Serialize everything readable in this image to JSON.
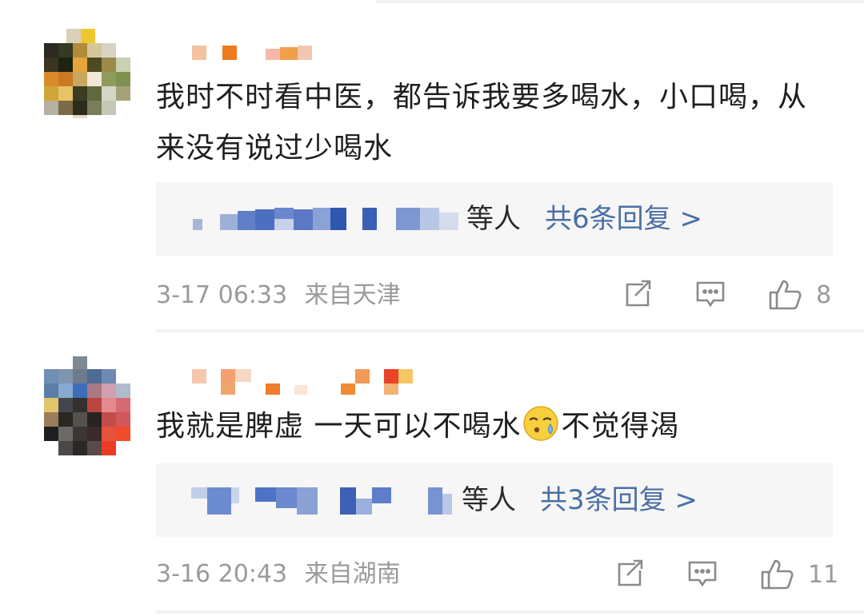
{
  "comments": [
    {
      "text": "我时不时看中医，都告诉我要多喝水，小口喝，从来没有说过少喝水",
      "reply_who": "等人",
      "reply_count": "共6条回复 >",
      "time": "3-17 06:33",
      "location": "来自天津",
      "likes": "8"
    },
    {
      "text_before_emoji": "我就是脾虚 一天可以不喝水",
      "text_after_emoji": "不觉得渴",
      "emoji_icon": "sweat-face-icon",
      "reply_who": "等人",
      "reply_count": "共3条回复 >",
      "time": "3-16 20:43",
      "location": "来自湖南",
      "likes": "11"
    }
  ],
  "colors": {
    "reply_link": "#4a6fa5",
    "meta_gray": "#9a9a9a",
    "reply_bg": "#f6f6f6"
  }
}
